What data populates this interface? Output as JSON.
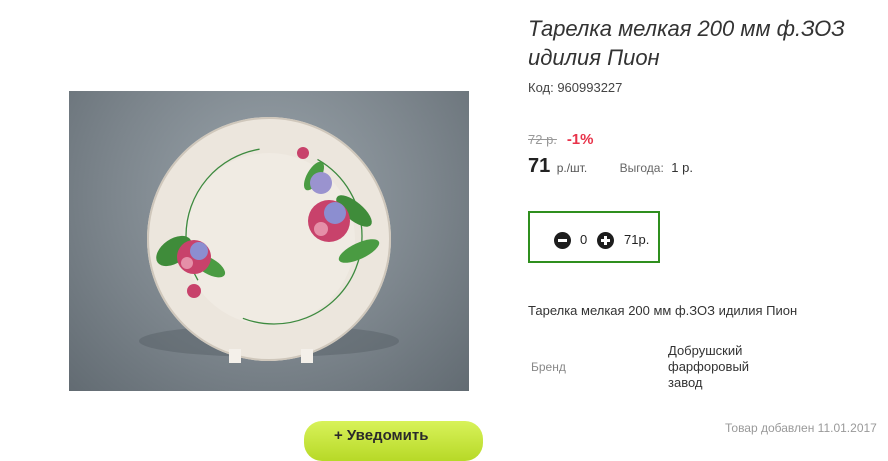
{
  "product": {
    "title": "Тарелка мелкая 200 мм ф.ЗОЗ идилия Пион",
    "sku": "Код: 960993227",
    "old_price": "72 р.",
    "discount": "-1%",
    "price": "71",
    "price_unit": "р./шт.",
    "saving_label": "Выгода:",
    "saving_value": "1 р.",
    "quantity": "0",
    "total": "71р.",
    "description": "Тарелка мелкая 200 мм ф.ЗОЗ идилия Пион",
    "brand_label": "Бренд",
    "brand_value": "Добрушский фарфоровый завод",
    "added": "Товар добавлен 11.01.2017",
    "add_button": "+ Уведомить"
  },
  "icons": {
    "minus": "minus-circle-icon",
    "plus": "plus-circle-icon"
  },
  "colors": {
    "accent_green": "#2f8f1e",
    "discount_red": "#e8334a",
    "button_lime": "#c6e43a"
  }
}
